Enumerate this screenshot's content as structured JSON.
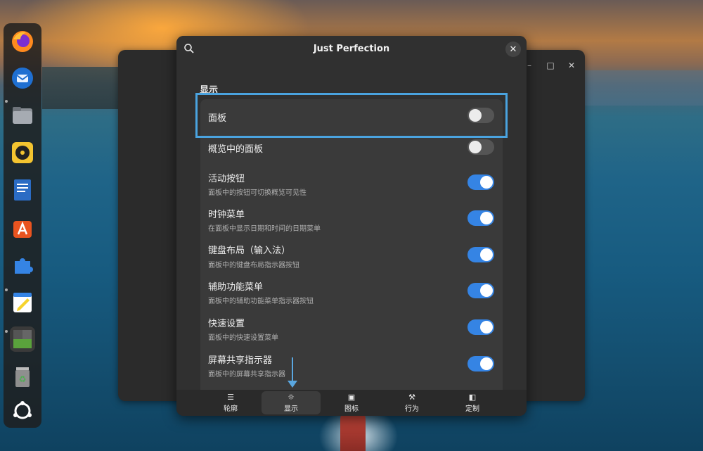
{
  "window": {
    "title": "Just Perfection",
    "search_icon": "search-icon",
    "close_icon": "close-icon",
    "section_title": "显示"
  },
  "settings": [
    {
      "title": "面板",
      "subtitle": "",
      "enabled": false
    },
    {
      "title": "概览中的面板",
      "subtitle": "",
      "enabled": false
    },
    {
      "title": "活动按钮",
      "subtitle": "面板中的按钮可切换概览可见性",
      "enabled": true
    },
    {
      "title": "时钟菜单",
      "subtitle": "在面板中显示日期和时间的日期菜单",
      "enabled": true
    },
    {
      "title": "键盘布局（输入法）",
      "subtitle": "面板中的键盘布局指示器按钮",
      "enabled": true
    },
    {
      "title": "辅助功能菜单",
      "subtitle": "面板中的辅助功能菜单指示器按钮",
      "enabled": true
    },
    {
      "title": "快速设置",
      "subtitle": "面板中的快速设置菜单",
      "enabled": true
    },
    {
      "title": "屏幕共享指示器",
      "subtitle": "面板中的屏幕共享指示器",
      "enabled": true
    }
  ],
  "tabs": [
    {
      "label": "轮廓",
      "icon": "list-icon",
      "active": false
    },
    {
      "label": "显示",
      "icon": "sun-icon",
      "active": true
    },
    {
      "label": "图标",
      "icon": "image-icon",
      "active": false
    },
    {
      "label": "行为",
      "icon": "wrench-icon",
      "active": false
    },
    {
      "label": "定制",
      "icon": "customize-icon",
      "active": false
    }
  ],
  "dock": [
    {
      "name": "firefox-icon",
      "color": "#e8692b"
    },
    {
      "name": "thunderbird-icon",
      "color": "#2a7fd4"
    },
    {
      "name": "files-icon",
      "color": "#7a7f86"
    },
    {
      "name": "rhythmbox-icon",
      "color": "#f4c430"
    },
    {
      "name": "writer-icon",
      "color": "#2b6cc4"
    },
    {
      "name": "app-center-icon",
      "color": "#e95420"
    },
    {
      "name": "extensions-icon",
      "color": "#3584e4"
    },
    {
      "name": "text-editor-icon",
      "color": "#f6d32d"
    },
    {
      "name": "extension-manager-icon",
      "color": "#5aa23c"
    },
    {
      "name": "trash-icon",
      "color": "#9b9b9b"
    },
    {
      "name": "show-apps-icon",
      "color": "#ffffff"
    }
  ],
  "colors": {
    "accent": "#3584e4",
    "highlight": "#4aa3df"
  }
}
